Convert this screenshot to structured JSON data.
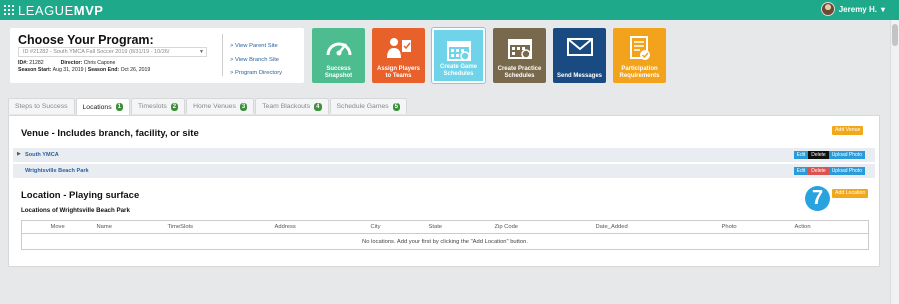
{
  "app": {
    "logo_light": "LEAGUE",
    "logo_bold": "MVP",
    "user_name": "Jeremy H."
  },
  "program": {
    "title": "Choose Your Program:",
    "selected": "ID #21282 - South YMCA Fall Soccer 2019 (8/31/19 - 10/26/",
    "id_label": "ID#:",
    "id_value": "21282",
    "director_label": "Director:",
    "director_value": "Chris Capone",
    "season_start_label": "Season Start:",
    "season_start_value": "Aug 31, 2019",
    "season_end_label": "Season End:",
    "season_end_value": "Oct 26, 2019",
    "links": [
      "> View Parent Site",
      "> View Branch Site",
      "> Program Directory"
    ]
  },
  "tiles": [
    {
      "label": "Success Snapshot",
      "color": "#4dbd8f",
      "icon": "gauge-icon"
    },
    {
      "label": "Assign Players to Teams",
      "color": "#e8602a",
      "icon": "assign-players-icon"
    },
    {
      "label": "Create Game Schedules",
      "color": "#6fd3ea",
      "icon": "calendar-icon"
    },
    {
      "label": "Create Practice Schedules",
      "color": "#79694c",
      "icon": "practice-calendar-icon"
    },
    {
      "label": "Send Messages",
      "color": "#1a4a82",
      "icon": "envelope-icon"
    },
    {
      "label": "Participation Requirements",
      "color": "#f2a21b",
      "icon": "document-check-icon"
    }
  ],
  "tabs": [
    {
      "label": "Steps to Success",
      "badge": ""
    },
    {
      "label": "Locations",
      "badge": "1"
    },
    {
      "label": "Timeslots",
      "badge": "2"
    },
    {
      "label": "Home Venues",
      "badge": "3"
    },
    {
      "label": "Team Blackouts",
      "badge": "4"
    },
    {
      "label": "Schedule Games",
      "badge": "5"
    }
  ],
  "venue": {
    "title": "Venue - Includes branch, facility, or site",
    "add_label": "Add Venue",
    "rows": [
      {
        "name": "South YMCA",
        "caret": "▶"
      },
      {
        "name": "Wrightsville Beach Park",
        "caret": ""
      }
    ],
    "actions": {
      "edit": "Edit",
      "delete": "Delete",
      "upload": "Upload Photo"
    }
  },
  "location": {
    "title": "Location - Playing surface",
    "subtitle": "Locations of Wrightsville Beach Park",
    "add_label": "Add Location",
    "step_number": "7",
    "columns": [
      "Move",
      "Name",
      "TimeSlots",
      "Address",
      "City",
      "State",
      "Zip Code",
      "Date_Added",
      "Photo",
      "Action"
    ],
    "empty_message": "No locations. Add your first by clicking the \"Add Location\" button."
  },
  "colors": {
    "brand": "#1ea98b",
    "accent_orange": "#f1a91b",
    "link_blue": "#2a5f9a",
    "step_badge": "#29a3e0"
  }
}
